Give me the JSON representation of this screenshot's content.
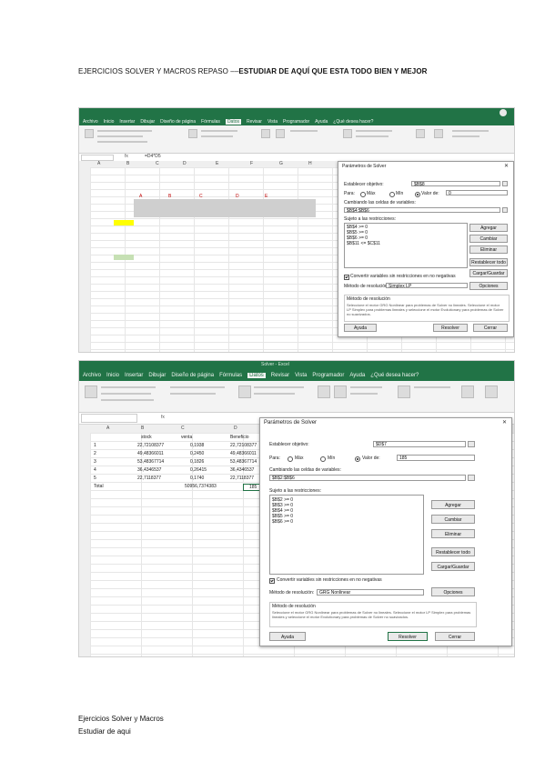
{
  "heading": {
    "prefix": "EJERCICIOS SOLVER Y MACROS REPASO ––",
    "bold": "ESTUDIAR DE AQUÍ QUE ESTA TODO BIEN Y MEJOR"
  },
  "shot1": {
    "menu": [
      "Archivo",
      "Inicio",
      "Insertar",
      "Dibujar",
      "Diseño de página",
      "Fórmulas",
      "Datos",
      "Revisar",
      "Vista",
      "Programador",
      "Ayuda",
      "¿Qué desea hacer?"
    ],
    "active_menu": "Datos",
    "formula": "=D4*D5",
    "columns": [
      "A",
      "B",
      "C",
      "D",
      "E",
      "F",
      "G",
      "H"
    ],
    "header_labels": [
      "A",
      "B",
      "C",
      "D",
      "E"
    ],
    "dialog": {
      "title": "Parámetros de Solver",
      "objective_label": "Establecer objetivo:",
      "objective_value": "$B$8",
      "to_label": "Para:",
      "opt_max": "Máx",
      "opt_min": "Mín",
      "opt_value": "Valor de:",
      "value_of": "0",
      "changing_label": "Cambiando las celdas de variables:",
      "changing_value": "$B$4:$B$6",
      "constraints_label": "Sujeto a las restricciones:",
      "constraints": [
        "$B$4 >= 0",
        "$B$5 >= 0",
        "$B$6 >= 0",
        "$B$11 <= $C$11"
      ],
      "btn_add": "Agregar",
      "btn_change": "Cambiar",
      "btn_delete": "Eliminar",
      "btn_reset": "Restablecer todo",
      "btn_load": "Cargar/Guardar",
      "nonneg": "Convertir variables sin restricciones en no negativas",
      "method_label": "Método de resolución:",
      "method_value": "Simplex LP",
      "btn_options": "Opciones",
      "help_title": "Método de resolución",
      "help_text": "Seleccione el motor GRG Nonlinear para problemas de Solver no lineales. Seleccione el motor LP Simplex para problemas lineales y seleccione el motor Evolutionary para problemas de Solver no suavizados.",
      "btn_help": "Ayuda",
      "btn_solve": "Resolver",
      "btn_close": "Cerrar"
    }
  },
  "shot2": {
    "title_text": "Solver - Excel",
    "menu": [
      "Archivo",
      "Inicio",
      "Insertar",
      "Dibujar",
      "Diseño de página",
      "Fórmulas",
      "Datos",
      "Revisar",
      "Vista",
      "Programador",
      "Ayuda",
      "¿Qué desea hacer?"
    ],
    "active_menu": "Datos",
    "name_box": "D7",
    "formula": "fx",
    "columns": [
      "A",
      "B",
      "C",
      "D",
      "E"
    ],
    "col_headers": [
      "stock",
      "venta",
      "Beneficio"
    ],
    "rows": [
      {
        "a": "1",
        "b": "22,72108377",
        "c": "0,1938",
        "d": "22,72108377"
      },
      {
        "a": "2",
        "b": "49,48366011",
        "c": "0,2450",
        "d": "49,48366011"
      },
      {
        "a": "3",
        "b": "53,48367714",
        "c": "0,1826",
        "d": "53,48367714"
      },
      {
        "a": "4",
        "b": "36,4346537",
        "c": "0,26415",
        "d": "36,4346537"
      },
      {
        "a": "5",
        "b": "22,7118377",
        "c": "0,1740",
        "d": "22,7118377"
      }
    ],
    "total_label": "Total",
    "total_c": "50956,7374383",
    "total_d": "185",
    "dialog": {
      "title": "Parámetros de Solver",
      "objective_label": "Establecer objetivo:",
      "objective_value": "$D$7",
      "to_label": "Para:",
      "opt_max": "Máx",
      "opt_min": "Mín",
      "opt_value": "Valor de:",
      "value_of": "185",
      "changing_label": "Cambiando las celdas de variables:",
      "changing_value": "$B$2:$B$6",
      "constraints_label": "Sujeto a las restricciones:",
      "constraints": [
        "$B$2 >= 0",
        "$B$3 >= 0",
        "$B$4 >= 0",
        "$B$5 >= 0",
        "$B$6 >= 0"
      ],
      "btn_add": "Agregar",
      "btn_change": "Cambiar",
      "btn_delete": "Eliminar",
      "btn_reset": "Restablecer todo",
      "btn_load": "Cargar/Guardar",
      "nonneg": "Convertir variables sin restricciones en no negativas",
      "method_label": "Método de resolución:",
      "method_value": "GRG Nonlinear",
      "btn_options": "Opciones",
      "help_title": "Método de resolución",
      "help_text": "Seleccione el motor GRG Nonlinear para problemas de Solver no lineales. Seleccione el motor LP Simplex para problemas lineales y seleccione el motor Evolutionary para problemas de Solver no suavizados.",
      "btn_help": "Ayuda",
      "btn_solve": "Resolver",
      "btn_close": "Cerrar"
    }
  },
  "footer": {
    "line1": "Ejercicios Solver y Macros",
    "line2": "Estudiar de aqui"
  }
}
